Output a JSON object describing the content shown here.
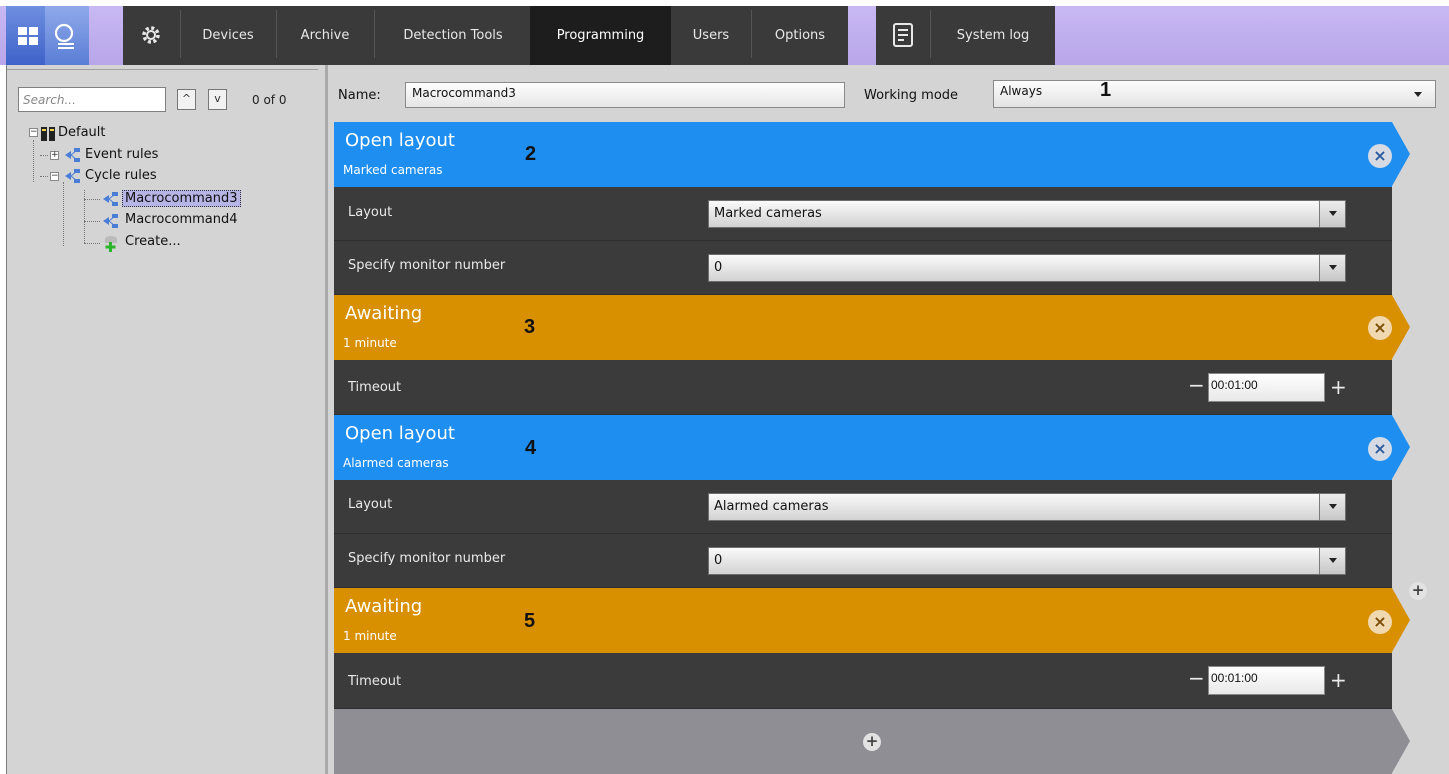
{
  "toolbar": {
    "tabs": [
      {
        "label": "Devices"
      },
      {
        "label": "Archive"
      },
      {
        "label": "Detection Tools"
      },
      {
        "label": "Programming"
      },
      {
        "label": "Users"
      },
      {
        "label": "Options"
      }
    ],
    "system_log": "System log",
    "active_tab": "Programming"
  },
  "tree": {
    "search_placeholder": "Search...",
    "count": "0 of 0",
    "items": [
      {
        "label": "Default"
      },
      {
        "label": "Event rules"
      },
      {
        "label": "Cycle rules"
      },
      {
        "label": "Macrocommand3"
      },
      {
        "label": "Macrocommand4"
      },
      {
        "label": "Create..."
      }
    ]
  },
  "editor": {
    "name_label": "Name:",
    "name_value": "Macrocommand3",
    "mode_label": "Working mode",
    "mode_value": "Always",
    "blocks": [
      {
        "num": "1"
      },
      {
        "num": "2",
        "title": "Open layout",
        "subtitle": "Marked cameras",
        "rows": [
          {
            "label": "Layout",
            "value": "Marked cameras"
          },
          {
            "label": "Specify monitor number",
            "value": "0"
          }
        ]
      },
      {
        "num": "3",
        "title": "Awaiting",
        "subtitle": "1 minute",
        "rows": [
          {
            "label": "Timeout",
            "value": "00:01:00"
          }
        ]
      },
      {
        "num": "4",
        "title": "Open layout",
        "subtitle": "Alarmed cameras",
        "rows": [
          {
            "label": "Layout",
            "value": "Alarmed cameras"
          },
          {
            "label": "Specify monitor number",
            "value": "0"
          }
        ]
      },
      {
        "num": "5",
        "title": "Awaiting",
        "subtitle": "1 minute",
        "rows": [
          {
            "label": "Timeout",
            "value": "00:01:00"
          }
        ]
      }
    ]
  },
  "colors": {
    "action_blue": "#1e8ef0",
    "wait_orange": "#d88f00",
    "row_dark": "#3b3b3b",
    "toolbar_dark": "#3a3a3a",
    "toolbar_lavender": "#c8b8f2"
  },
  "icons": {
    "layouts": "grid-icon",
    "search": "search-icon",
    "settings": "gear-icon",
    "system_log": "log-icon",
    "remove": "close-icon",
    "add": "plus-icon"
  }
}
